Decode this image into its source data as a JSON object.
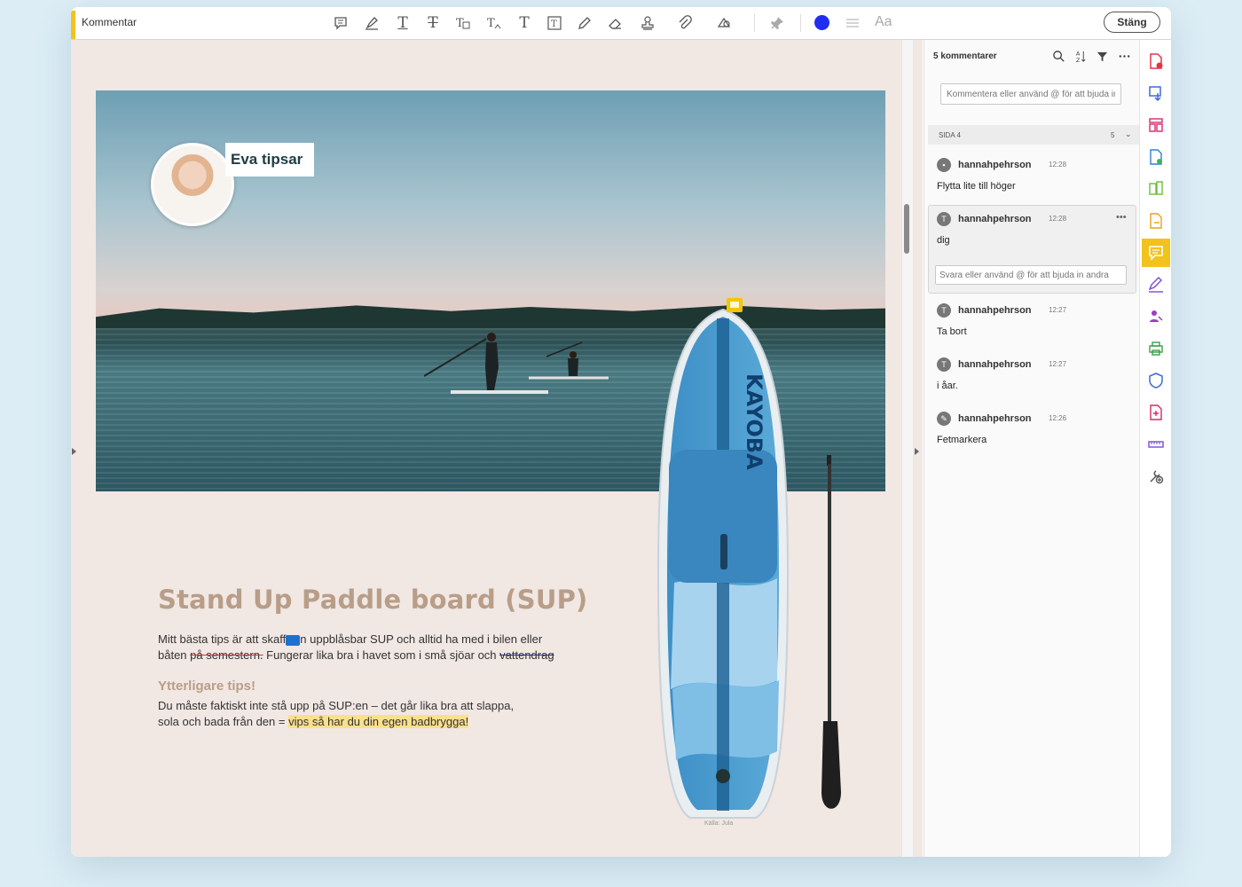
{
  "toolbar": {
    "title": "Kommentar",
    "tools": [
      "sticky-note-icon",
      "highlight-icon",
      "underline-text-icon",
      "strikethrough-text-icon",
      "replace-text-icon",
      "insert-text-icon",
      "add-text-icon",
      "text-box-icon",
      "pencil-icon",
      "eraser-icon",
      "stamp-icon",
      "attach-file-icon",
      "shapes-icon",
      "pin-icon"
    ],
    "color": "#1f2ef0",
    "text_style_label": "Aa",
    "close_label": "Stäng"
  },
  "document": {
    "badge_label": "Eva tipsar",
    "board_brand": "KAYOBA",
    "photo_credit": "Källa: Jula",
    "title": "Stand Up Paddle board (SUP)",
    "para1_a": "Mitt bästa tips är att skaff",
    "para1_b": "n uppblåsbar SUP och alltid ha med i bilen eller",
    "para1_c": "båten ",
    "para1_strike": "på semestern.",
    "para1_d": " Fungerar lika bra i havet som i små sjöar och ",
    "para1_strike2": "vattendrag",
    "subheading": "Ytterligare tips!",
    "para2_a": "Du måste faktiskt inte stå ",
    "para2_b": "upp på SUP:en – det går lika bra att slappa,",
    "para2_c": "sola och bada från den = ",
    "para2_highlight": "vips så har du din egen badbrygga!"
  },
  "panel": {
    "heading": "5 kommentarer",
    "comment_placeholder": "Kommentera eller använd @ för att bjuda in andra",
    "page_group": {
      "label": "SIDA 4",
      "count": "5"
    },
    "reply_placeholder": "Svara eller använd @ för att bjuda in andra",
    "comments": [
      {
        "author": "hannahpehrson",
        "time": "12:28",
        "text": "Flytta lite till höger",
        "icon": "comment-bubble-icon"
      },
      {
        "author": "hannahpehrson",
        "time": "12:28",
        "text": "dig",
        "icon": "insert-text-icon"
      },
      {
        "author": "hannahpehrson",
        "time": "12:27",
        "text": "Ta bort",
        "icon": "strikethrough-icon"
      },
      {
        "author": "hannahpehrson",
        "time": "12:27",
        "text": "i åar.",
        "icon": "replace-text-icon"
      },
      {
        "author": "hannahpehrson",
        "time": "12:26",
        "text": "Fetmarkera",
        "icon": "highlight-icon"
      }
    ]
  },
  "rail": [
    "create-pdf-icon",
    "export-pdf-icon",
    "organize-pages-icon",
    "edit-pdf-icon",
    "combine-files-icon",
    "export-file-icon",
    "comment-icon",
    "fill-sign-icon",
    "request-signature-icon",
    "print-production-icon",
    "protect-icon",
    "compress-icon",
    "measure-icon",
    "more-tools-icon"
  ]
}
